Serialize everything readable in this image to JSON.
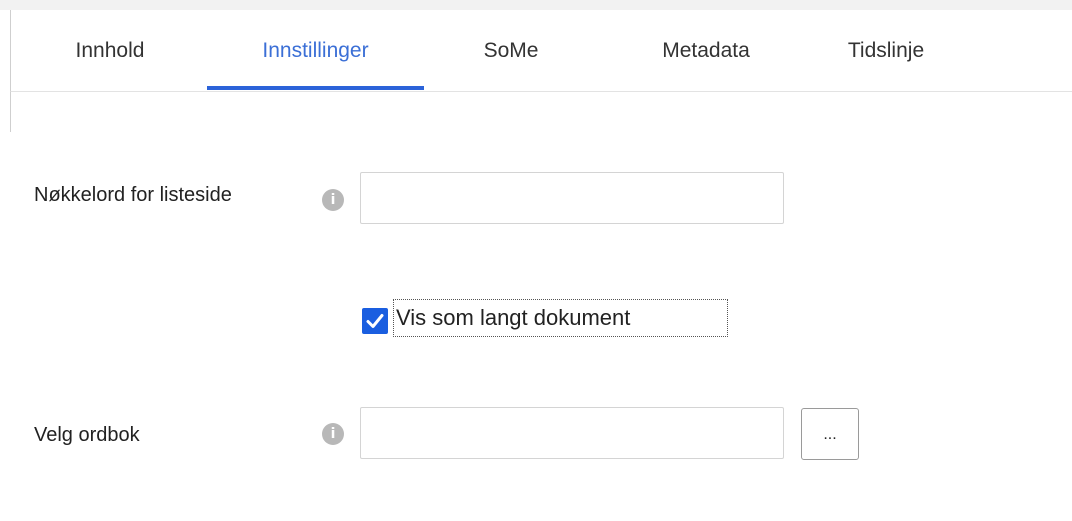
{
  "tabs": [
    {
      "label": "Innhold",
      "active": false
    },
    {
      "label": "Innstillinger",
      "active": true
    },
    {
      "label": "SoMe",
      "active": false
    },
    {
      "label": "Metadata",
      "active": false
    },
    {
      "label": "Tidslinje",
      "active": false
    }
  ],
  "form": {
    "keywords": {
      "label": "Nøkkelord for listeside",
      "value": "",
      "info_icon": "info-icon"
    },
    "long_document": {
      "label": "Vis som langt dokument",
      "checked": true
    },
    "dictionary": {
      "label": "Velg ordbok",
      "value": "",
      "info_icon": "info-icon",
      "browse_label": "..."
    }
  },
  "colors": {
    "accent": "#2b63d9",
    "active_tab_text": "#3b6fd6",
    "checkbox": "#1a5ee0",
    "info_icon": "#b8b8b8"
  }
}
